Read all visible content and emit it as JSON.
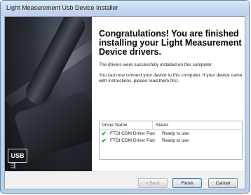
{
  "window": {
    "title": "Light Measurement Usb Device Installer"
  },
  "banner": {
    "usb_logo": "USB"
  },
  "content": {
    "heading": "Congratulations! You are finished installing your Light Measurement Device drivers.",
    "paragraph1": "The drivers were successfully installed on this computer.",
    "paragraph2": "You can now connect your device to this computer. If your device came with instructions, please read them first."
  },
  "driver_list": {
    "columns": [
      "Driver Name",
      "Status"
    ],
    "rows": [
      {
        "name": "FTDI CDM Driver Packa...",
        "status": "Ready to use",
        "icon": "check-icon"
      },
      {
        "name": "FTDI CDM Driver Packa...",
        "status": "Ready to use",
        "icon": "check-icon"
      }
    ]
  },
  "buttons": {
    "back": "< Back",
    "finish": "Finish",
    "cancel": "Cancel"
  }
}
